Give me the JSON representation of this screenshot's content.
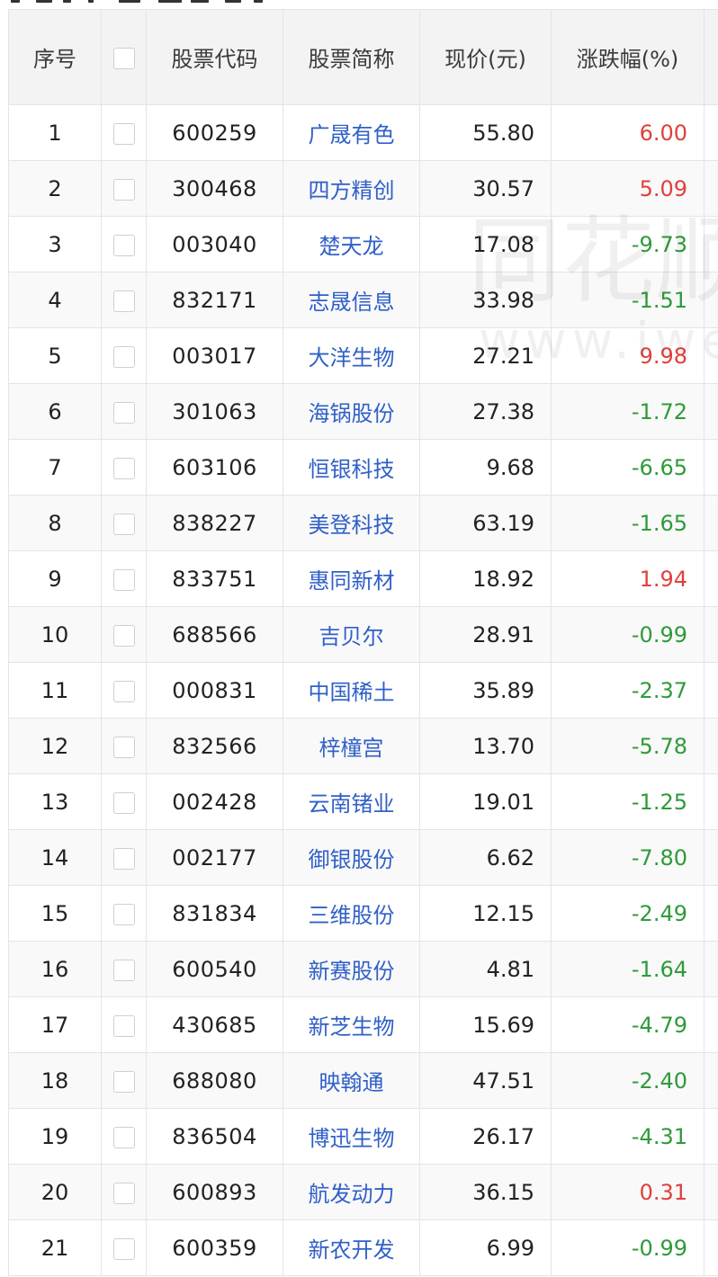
{
  "table": {
    "headers": {
      "index": "序号",
      "code": "股票代码",
      "name": "股票简称",
      "price": "现价(元)",
      "change": "涨跌幅(%)"
    },
    "rows": [
      {
        "index": "1",
        "code": "600259",
        "name": "广晟有色",
        "price": "55.80",
        "change": "6.00",
        "direction": "up"
      },
      {
        "index": "2",
        "code": "300468",
        "name": "四方精创",
        "price": "30.57",
        "change": "5.09",
        "direction": "up"
      },
      {
        "index": "3",
        "code": "003040",
        "name": "楚天龙",
        "price": "17.08",
        "change": "-9.73",
        "direction": "down"
      },
      {
        "index": "4",
        "code": "832171",
        "name": "志晟信息",
        "price": "33.98",
        "change": "-1.51",
        "direction": "down"
      },
      {
        "index": "5",
        "code": "003017",
        "name": "大洋生物",
        "price": "27.21",
        "change": "9.98",
        "direction": "up"
      },
      {
        "index": "6",
        "code": "301063",
        "name": "海锅股份",
        "price": "27.38",
        "change": "-1.72",
        "direction": "down"
      },
      {
        "index": "7",
        "code": "603106",
        "name": "恒银科技",
        "price": "9.68",
        "change": "-6.65",
        "direction": "down"
      },
      {
        "index": "8",
        "code": "838227",
        "name": "美登科技",
        "price": "63.19",
        "change": "-1.65",
        "direction": "down"
      },
      {
        "index": "9",
        "code": "833751",
        "name": "惠同新材",
        "price": "18.92",
        "change": "1.94",
        "direction": "up"
      },
      {
        "index": "10",
        "code": "688566",
        "name": "吉贝尔",
        "price": "28.91",
        "change": "-0.99",
        "direction": "down"
      },
      {
        "index": "11",
        "code": "000831",
        "name": "中国稀土",
        "price": "35.89",
        "change": "-2.37",
        "direction": "down"
      },
      {
        "index": "12",
        "code": "832566",
        "name": "梓橦宫",
        "price": "13.70",
        "change": "-5.78",
        "direction": "down"
      },
      {
        "index": "13",
        "code": "002428",
        "name": "云南锗业",
        "price": "19.01",
        "change": "-1.25",
        "direction": "down"
      },
      {
        "index": "14",
        "code": "002177",
        "name": "御银股份",
        "price": "6.62",
        "change": "-7.80",
        "direction": "down"
      },
      {
        "index": "15",
        "code": "831834",
        "name": "三维股份",
        "price": "12.15",
        "change": "-2.49",
        "direction": "down"
      },
      {
        "index": "16",
        "code": "600540",
        "name": "新赛股份",
        "price": "4.81",
        "change": "-1.64",
        "direction": "down"
      },
      {
        "index": "17",
        "code": "430685",
        "name": "新芝生物",
        "price": "15.69",
        "change": "-4.79",
        "direction": "down"
      },
      {
        "index": "18",
        "code": "688080",
        "name": "映翰通",
        "price": "47.51",
        "change": "-2.40",
        "direction": "down"
      },
      {
        "index": "19",
        "code": "836504",
        "name": "博迅生物",
        "price": "26.17",
        "change": "-4.31",
        "direction": "down"
      },
      {
        "index": "20",
        "code": "600893",
        "name": "航发动力",
        "price": "36.15",
        "change": "0.31",
        "direction": "up"
      },
      {
        "index": "21",
        "code": "600359",
        "name": "新农开发",
        "price": "6.99",
        "change": "-0.99",
        "direction": "down"
      }
    ]
  },
  "watermark": {
    "main": "同花顺",
    "sub": "www.iwencai.com"
  },
  "colors": {
    "up": "#e0403c",
    "down": "#2e9a3a",
    "link": "#3060c8",
    "header_bg": "#f3f3f3",
    "border": "#e4e4e4"
  }
}
